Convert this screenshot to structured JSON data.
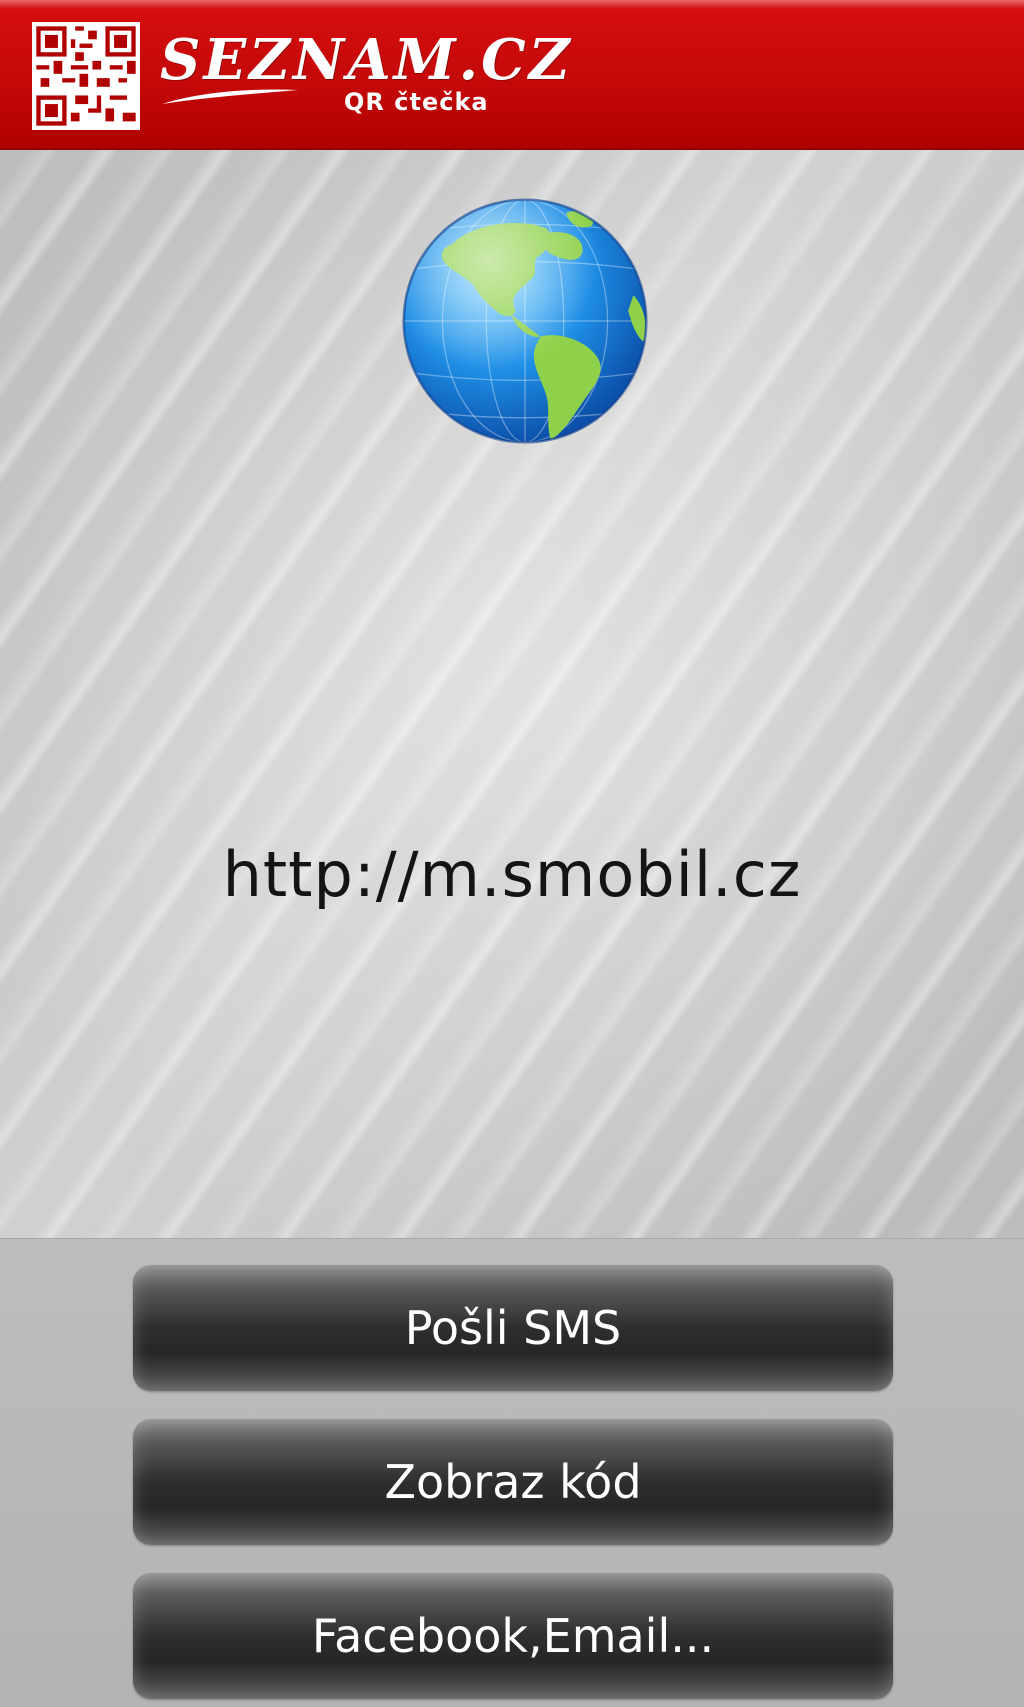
{
  "header": {
    "logo_text": "SEZNAM.CZ",
    "subtitle": "QR čtečka",
    "brand_color": "#c30808"
  },
  "main": {
    "icon": "globe-icon",
    "url": "http://m.smobil.cz"
  },
  "actions": {
    "send_sms_label": "Pošli SMS",
    "show_code_label": "Zobraz kód",
    "share_label": "Facebook,Email..."
  }
}
